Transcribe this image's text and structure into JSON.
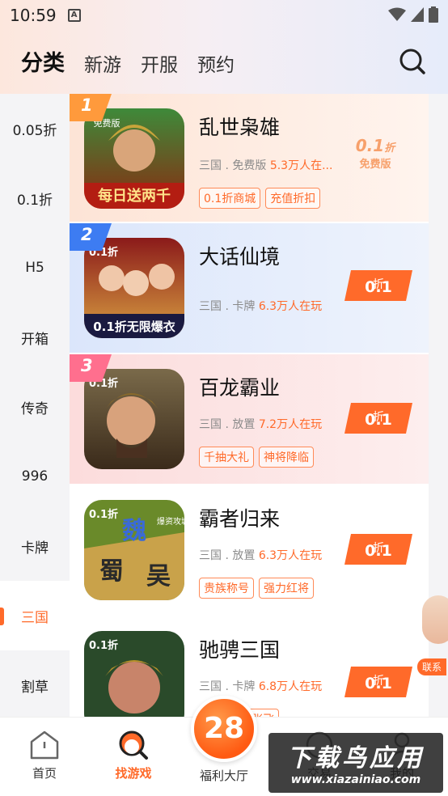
{
  "status_bar": {
    "time": "10:59",
    "notification_letter": "A"
  },
  "top_tabs": [
    {
      "label": "分类",
      "active": true
    },
    {
      "label": "新游",
      "active": false
    },
    {
      "label": "开服",
      "active": false
    },
    {
      "label": "预约",
      "active": false
    }
  ],
  "sidebar": {
    "items": [
      {
        "label": "0.05折",
        "active": false
      },
      {
        "label": "0.1折",
        "active": false
      },
      {
        "label": "H5",
        "active": false
      },
      {
        "label": "开箱",
        "active": false
      },
      {
        "label": "传奇",
        "active": false
      },
      {
        "label": "996",
        "active": false
      },
      {
        "label": "卡牌",
        "active": false
      },
      {
        "label": "三国",
        "active": true
      },
      {
        "label": "割草",
        "active": false
      }
    ]
  },
  "games": [
    {
      "rank": "1",
      "title": "乱世枭雄",
      "category": "三国 . 免费版",
      "players": "5.3万人在...",
      "tags": [
        "0.1折商城",
        "充值折扣"
      ],
      "badge_value": "0.1",
      "badge_unit": "折",
      "badge_label": "免费版",
      "icon_caption": "每日送两千",
      "icon_corner": "免费版"
    },
    {
      "rank": "2",
      "title": "大话仙境",
      "category": "三国 . 卡牌",
      "players": "6.3万人在玩",
      "tags": [],
      "discount_value": "0.1",
      "discount_unit": "折",
      "icon_caption": "0.1折无限爆衣",
      "icon_corner": "0.1折"
    },
    {
      "rank": "3",
      "title": "百龙霸业",
      "category": "三国 . 放置",
      "players": "7.2万人在玩",
      "tags": [
        "千抽大礼",
        "神将降临"
      ],
      "discount_value": "0.1",
      "discount_unit": "折",
      "icon_corner": "0.1折"
    },
    {
      "rank": "",
      "title": "霸者归来",
      "category": "三国 . 放置",
      "players": "6.3万人在玩",
      "tags": [
        "贵族称号",
        "强力红将"
      ],
      "discount_value": "0.1",
      "discount_unit": "折",
      "icon_corner": "0.1折",
      "icon_chars": [
        "魏",
        "蜀",
        "吴"
      ],
      "icon_ribbon": "爆资攻城"
    },
    {
      "rank": "",
      "title": "驰骋三国",
      "category": "三国 . 卡牌",
      "players": "6.8万人在玩",
      "tags": [
        "...",
        "五星张飞"
      ],
      "discount_value": "0.1",
      "discount_unit": "折",
      "icon_corner": "0.1折"
    }
  ],
  "float_contact": {
    "label": "联系"
  },
  "bottom_nav": {
    "home": "首页",
    "find_game": "找游戏",
    "welfare": "福利大厅",
    "center_badge": "28",
    "deals": "交易",
    "mine": "我的"
  },
  "watermark": {
    "line1": "下载鸟应用",
    "line2": "www.xiazainiao.com"
  },
  "colors": {
    "accent": "#ff6a2a",
    "tag_border": "#ff8a57"
  }
}
